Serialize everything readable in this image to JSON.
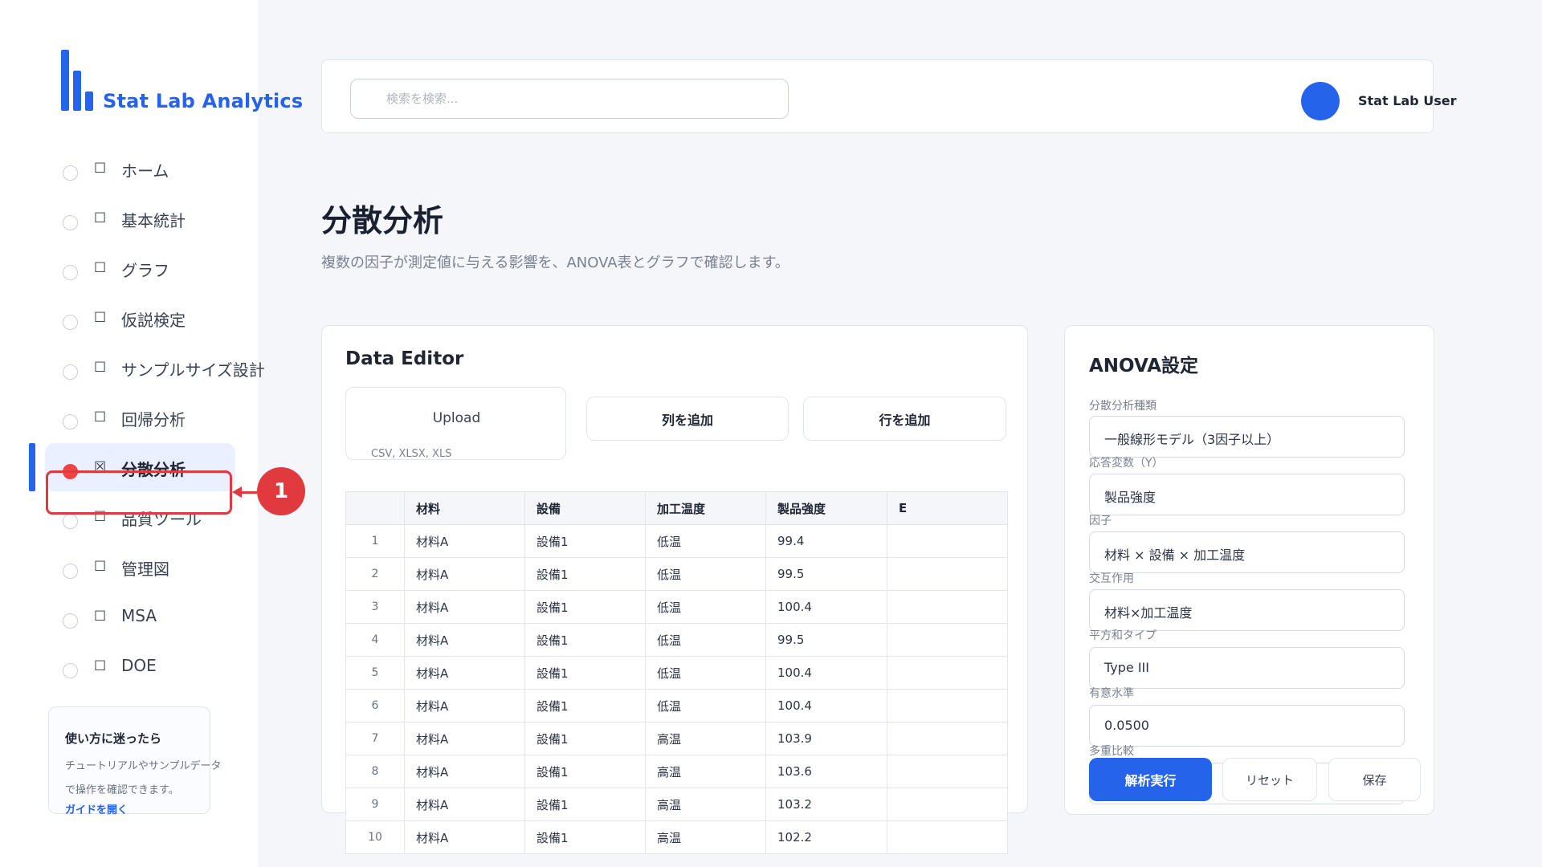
{
  "brand": {
    "name": "Stat Lab Analytics"
  },
  "sidebar": {
    "items": [
      {
        "label": "ホーム",
        "icon": "☐"
      },
      {
        "label": "基本統計",
        "icon": "☐"
      },
      {
        "label": "グラフ",
        "icon": "☐"
      },
      {
        "label": "仮説検定",
        "icon": "☐"
      },
      {
        "label": "サンプルサイズ設計",
        "icon": "☐"
      },
      {
        "label": "回帰分析",
        "icon": "☐"
      },
      {
        "label": "分散分析",
        "icon": "☒",
        "active": true
      },
      {
        "label": "品質ツール",
        "icon": "☐"
      },
      {
        "label": "管理図",
        "icon": "☐"
      },
      {
        "label": "MSA",
        "icon": "☐"
      },
      {
        "label": "DOE",
        "icon": "☐"
      }
    ],
    "help": {
      "title": "使い方に迷ったら",
      "body": "チュートリアルやサンプルデータで操作を確認できます。",
      "link": "ガイドを開く"
    }
  },
  "annotation": {
    "marker": "1",
    "color": "#e0393e"
  },
  "header": {
    "search_placeholder": "検索を検索...",
    "user_name": "Stat Lab User"
  },
  "page": {
    "title": "分散分析",
    "description": "複数の因子が測定値に与える影響を、ANOVA表とグラフで確認します。"
  },
  "editor": {
    "title": "Data Editor",
    "upload_label": "Upload",
    "upload_formats": "CSV, XLSX, XLS",
    "add_column": "列を追加",
    "add_row": "行を追加",
    "columns": [
      "",
      "材料",
      "設備",
      "加工温度",
      "製品強度",
      "E"
    ],
    "rows": [
      [
        "1",
        "材料A",
        "設備1",
        "低温",
        "99.4",
        ""
      ],
      [
        "2",
        "材料A",
        "設備1",
        "低温",
        "99.5",
        ""
      ],
      [
        "3",
        "材料A",
        "設備1",
        "低温",
        "100.4",
        ""
      ],
      [
        "4",
        "材料A",
        "設備1",
        "低温",
        "99.5",
        ""
      ],
      [
        "5",
        "材料A",
        "設備1",
        "低温",
        "100.4",
        ""
      ],
      [
        "6",
        "材料A",
        "設備1",
        "低温",
        "100.4",
        ""
      ],
      [
        "7",
        "材料A",
        "設備1",
        "高温",
        "103.9",
        ""
      ],
      [
        "8",
        "材料A",
        "設備1",
        "高温",
        "103.6",
        ""
      ],
      [
        "9",
        "材料A",
        "設備1",
        "高温",
        "103.2",
        ""
      ],
      [
        "10",
        "材料A",
        "設備1",
        "高温",
        "102.2",
        ""
      ]
    ]
  },
  "anova": {
    "title": "ANOVA設定",
    "fields": [
      {
        "label": "分散分析種類",
        "value": "一般線形モデル（3因子以上）"
      },
      {
        "label": "応答変数（Y）",
        "value": "製品強度"
      },
      {
        "label": "因子",
        "value": "材料 × 設備 × 加工温度"
      },
      {
        "label": "交互作用",
        "value": "材料×加工温度"
      },
      {
        "label": "平方和タイプ",
        "value": "Type III"
      },
      {
        "label": "有意水準",
        "value": "0.0500"
      },
      {
        "label": "多重比較",
        "value": ""
      }
    ],
    "run": "解析実行",
    "reset": "リセット",
    "save": "保存"
  },
  "colors": {
    "accent": "#2563eb",
    "active_bg": "#eaf0ff",
    "annotation": "#e0393e"
  }
}
